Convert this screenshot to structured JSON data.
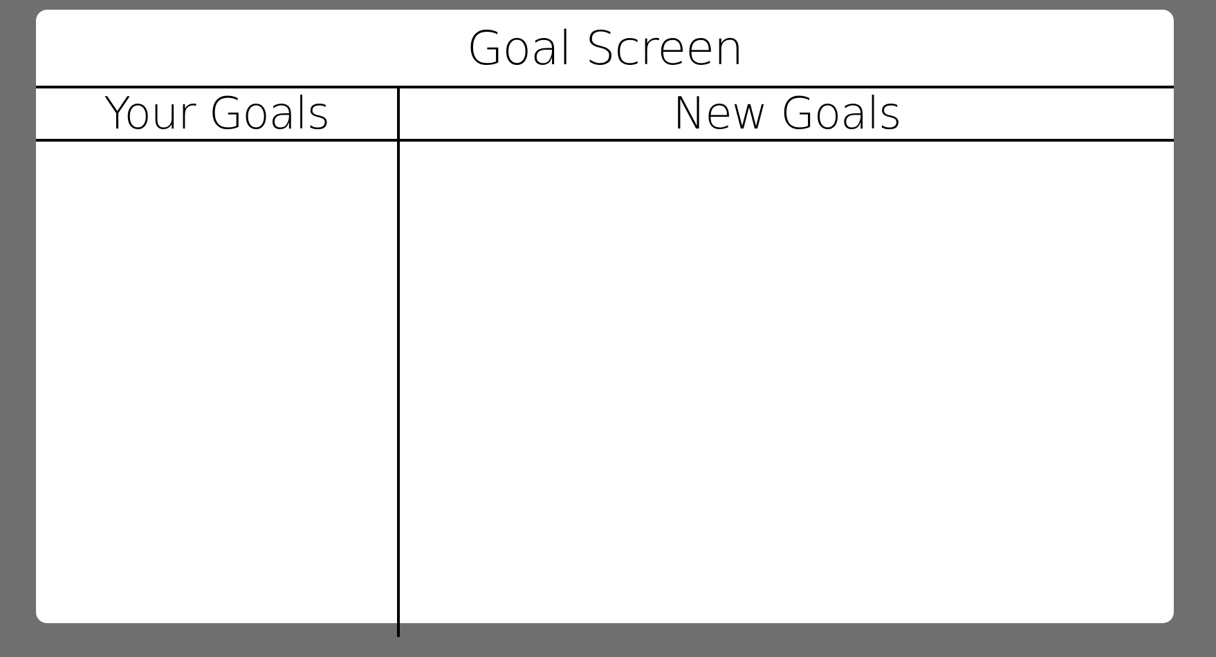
{
  "screen": {
    "title": "Goal Screen"
  },
  "columns": {
    "your_goals": {
      "header": "Your Goals",
      "items": []
    },
    "new_goals": {
      "header": "New Goals",
      "items": []
    }
  }
}
